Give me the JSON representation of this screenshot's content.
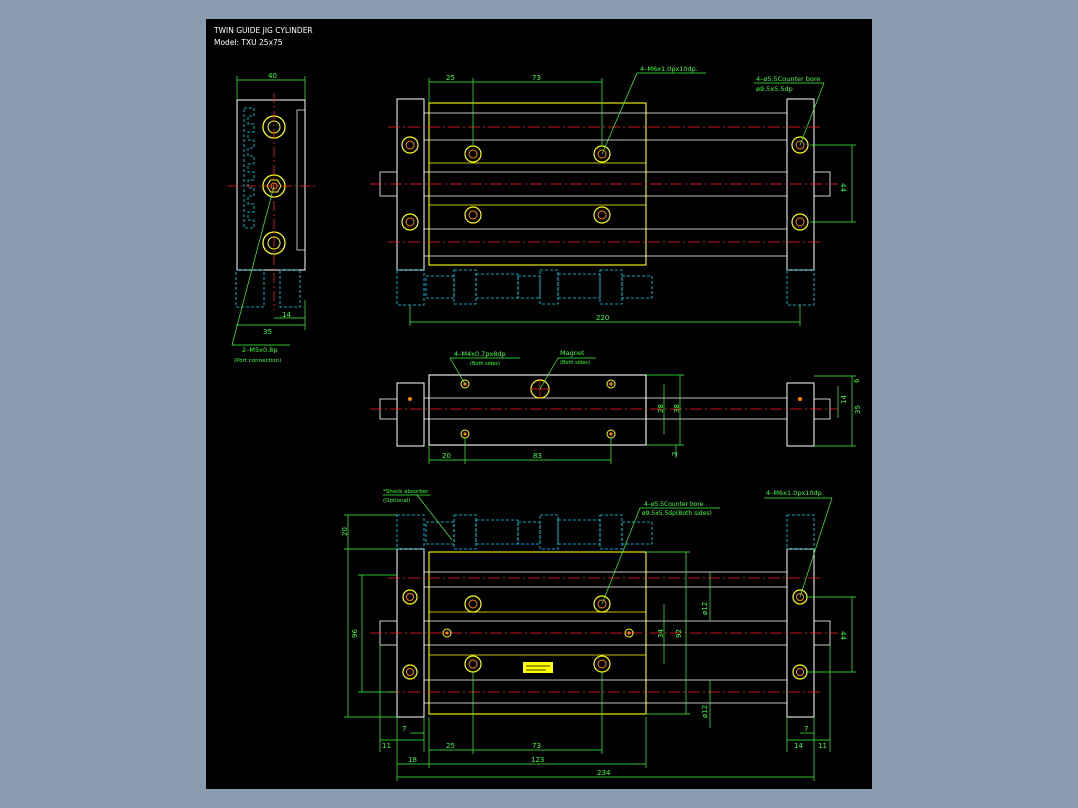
{
  "title": {
    "line1": "TWIN GUIDE JIG CYLINDER",
    "line2": "Model: TXU 25x75"
  },
  "colors": {
    "background": "#000000",
    "frame": "#8a9db0",
    "outline": "#ffffff",
    "body": "#ffff00",
    "dimension": "#33ff33",
    "centerline": "#ff2020",
    "hidden": "#00e0ff",
    "screw": "#ff8000"
  },
  "side_view": {
    "dims": {
      "top_width": "40",
      "bottom_width": "35",
      "offset": "14"
    },
    "callout": {
      "label": "2–M5x0.8p",
      "sublabel": "(Port connection)"
    }
  },
  "top_view": {
    "dims": {
      "d1": "25",
      "d2": "73",
      "overall": "220",
      "right": "44"
    },
    "callouts": [
      {
        "label": "4–M6x1.0px10dp."
      },
      {
        "label": "4–ø5.5Counter bore",
        "sublabel": "ø9.5x5.5dp"
      }
    ]
  },
  "front_view": {
    "dims": {
      "d1": "20",
      "d2": "83",
      "h1": "28",
      "h2": "38",
      "r1": "6",
      "r2": "14",
      "r3": "35",
      "low": "2"
    },
    "callouts": [
      {
        "label": "4–M4x0.7px8dp",
        "sublabel": "(Both sides)"
      },
      {
        "label": "Magnet",
        "sublabel": "(Both sides)"
      }
    ]
  },
  "bottom_view": {
    "dims": {
      "d1": "25",
      "d2": "73",
      "d3": "123",
      "d4": "234",
      "d5": "18",
      "l11": "11",
      "l7": "7",
      "r7": "7",
      "r14": "14",
      "r11": "11",
      "v20": "20",
      "v96": "96",
      "v92": "92",
      "v34": "34",
      "v44": "44",
      "dia_top": "ø12",
      "dia_bot": "ø12"
    },
    "callouts": [
      {
        "label": "*Shock absorber",
        "sublabel": "(Optional)"
      },
      {
        "label": "4–ø5.5Counter bore",
        "sublabel": "ø9.5x5.5dp(Both sides)"
      },
      {
        "label": "4–M6x1.0px10dp."
      }
    ]
  }
}
